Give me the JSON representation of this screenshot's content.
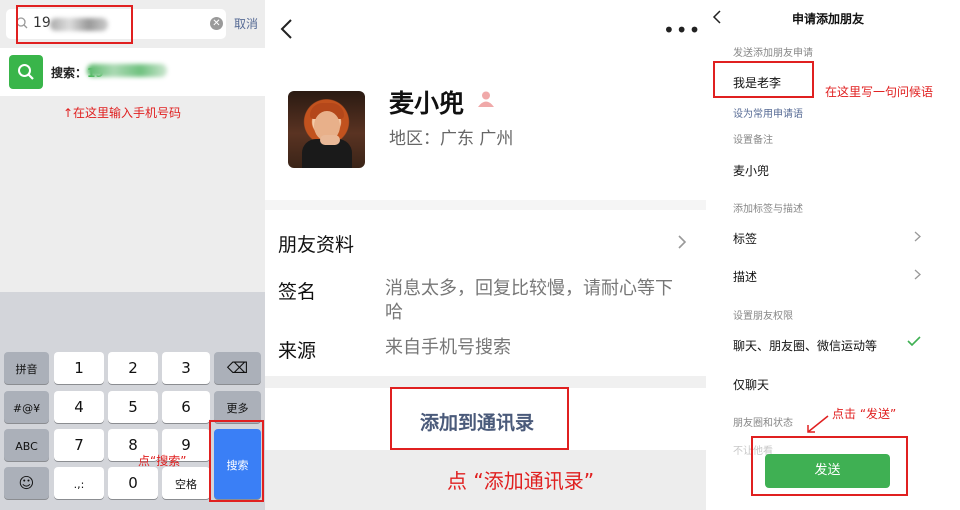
{
  "panel1": {
    "search_value_prefix": "19",
    "cancel_label": "取消",
    "result_prefix": "搜索：",
    "result_digits": "19",
    "hint_input": "↑在这里输入手机号码",
    "hint_search": "点“搜索”",
    "keyboard": {
      "left_keys": [
        "拼音",
        "#@¥",
        "ABC",
        "☺"
      ],
      "digits": [
        [
          "1",
          "2",
          "3"
        ],
        [
          "4",
          "5",
          "6"
        ],
        [
          "7",
          "8",
          "9"
        ]
      ],
      "bottom": [
        ".,:",
        "0",
        "空格"
      ],
      "right_top": "⌫",
      "right_more": "更多",
      "search_key": "搜索"
    },
    "colors": {
      "accent_green": "#39b54a",
      "key_blue": "#3a7ff6",
      "hint_red": "#e02020"
    }
  },
  "panel2": {
    "more_label": "•••",
    "nickname": "麦小兜",
    "region": "地区：广东 广州",
    "friend_profile": "朋友资料",
    "signature_label": "签名",
    "signature_value": "消息太多，回复比较慢，请耐心等下哈",
    "source_label": "来源",
    "source_value": "来自手机号搜索",
    "add_button": "添加到通讯录",
    "hint_add": "点 “添加通讯录”"
  },
  "panel3": {
    "title": "申请添加朋友",
    "section_request": "发送添加朋友申请",
    "request_message": "我是老李",
    "hint_greeting": "在这里写一句问候语",
    "set_common": "设为常用申请语",
    "section_remark": "设置备注",
    "remark_value": "麦小兜",
    "section_tags": "添加标签与描述",
    "tags_label": "标签",
    "desc_label": "描述",
    "section_permission": "设置朋友权限",
    "perm_all": "聊天、朋友圈、微信运动等",
    "perm_chat_only": "仅聊天",
    "section_moments": "朋友圈和状态",
    "faded_text": "不让他看",
    "hint_send": "点击 “发送”",
    "send_button": "发送",
    "colors": {
      "send_green": "#3fb053",
      "check_green": "#3fb053"
    }
  }
}
